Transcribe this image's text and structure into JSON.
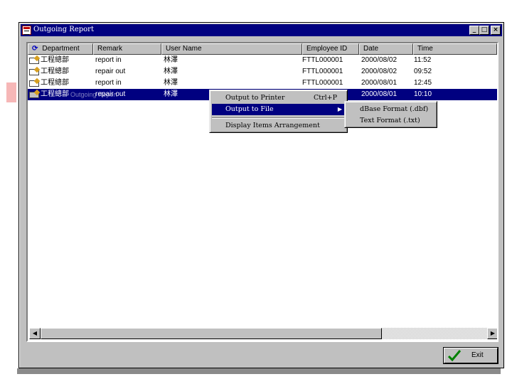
{
  "window": {
    "title": "Outgoing Report",
    "buttons": [
      "_",
      "□",
      "×"
    ]
  },
  "table": {
    "columns": [
      "Department",
      "Remark",
      "User Name",
      "Employee ID",
      "Date",
      "Time"
    ],
    "rows": [
      {
        "department": "工程總部",
        "remark": "report in",
        "user": "林澤",
        "employee_id": "FTTL000001",
        "date": "2000/08/02",
        "time": "11:52"
      },
      {
        "department": "工程總部",
        "remark": "repair out",
        "user": "林澤",
        "employee_id": "FTTL000001",
        "date": "2000/08/02",
        "time": "09:52"
      },
      {
        "department": "工程總部",
        "remark": "report in",
        "user": "林澤",
        "employee_id": "FTTL000001",
        "date": "2000/08/01",
        "time": "12:45"
      },
      {
        "department": "工程總部",
        "remark": "repair out",
        "user": "林澤",
        "employee_id": "FTTL000001",
        "date": "2000/08/01",
        "time": "10:10",
        "selected": true
      }
    ],
    "ghost_text": "Outgoing Report"
  },
  "context_menu": {
    "items": [
      {
        "label": "Output to Printer",
        "shortcut": "Ctrl+P"
      },
      {
        "label": "Output to File",
        "submenu": true
      },
      {
        "label": "Display Items Arrangement"
      }
    ],
    "submenu": [
      "dBase Format (.dbf)",
      "Text Format (.txt)"
    ]
  },
  "exit_button": {
    "label": "Exit"
  },
  "colors": {
    "selection": "#000080",
    "titlebar": "#000080",
    "face": "#c0c0c0",
    "check": "#008000"
  },
  "icons": [
    "refresh-sort-icon",
    "report-row-icon",
    "check-icon",
    "submenu-arrow-icon"
  ]
}
